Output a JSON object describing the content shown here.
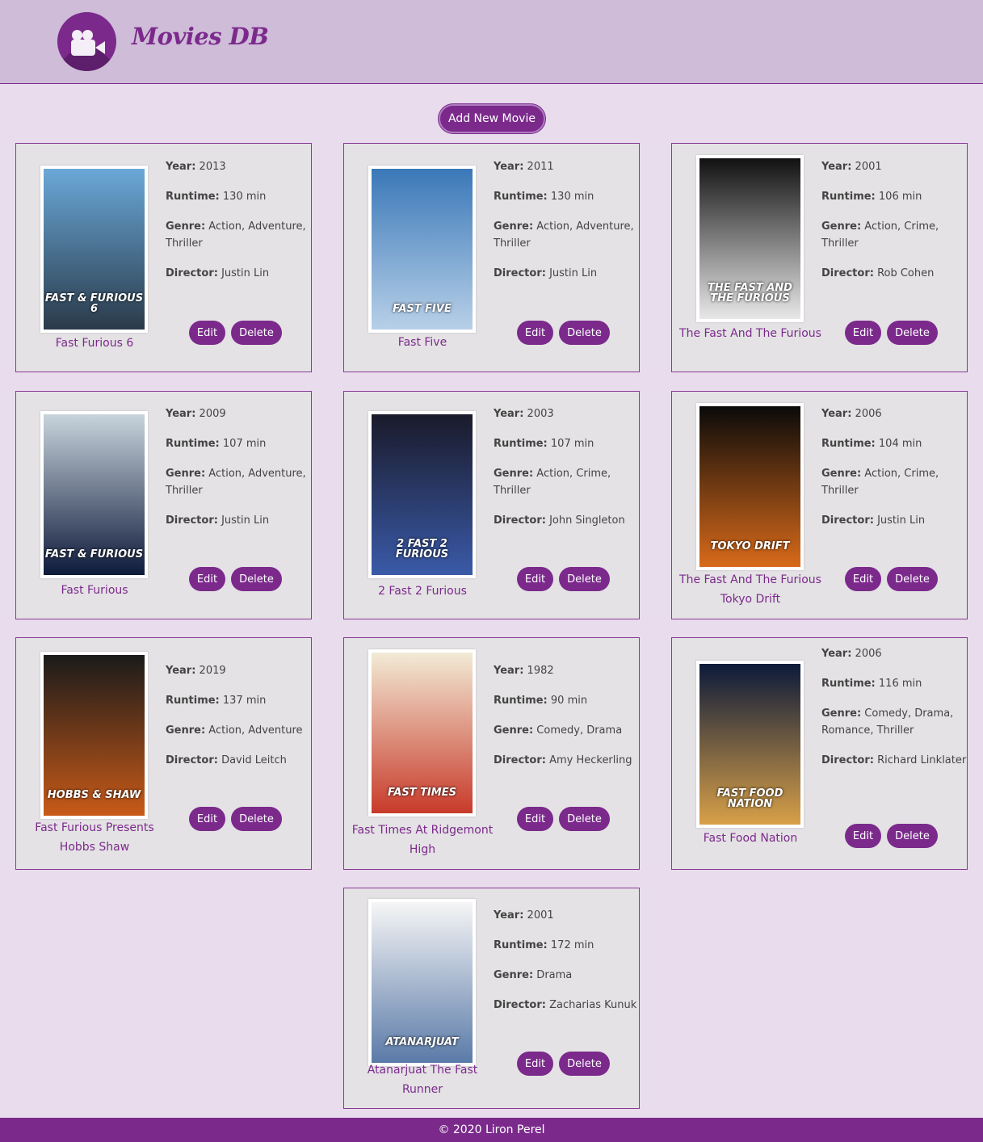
{
  "app": {
    "brand": "Movies DB"
  },
  "actions": {
    "add_label": "Add New Movie",
    "edit_label": "Edit",
    "delete_label": "Delete"
  },
  "labels": {
    "year": "Year:",
    "runtime": "Runtime:",
    "genre": "Genre:",
    "director": "Director:"
  },
  "movies": [
    {
      "title": "Fast Furious 6",
      "year": "2013",
      "runtime": "130 min",
      "genre": "Action, Adventure, Thriller",
      "director": "Justin Lin",
      "poster_text": "FAST & FURIOUS 6",
      "poster_colors": [
        "#6aa8d8",
        "#2a3a4a"
      ]
    },
    {
      "title": "Fast Five",
      "year": "2011",
      "runtime": "130 min",
      "genre": "Action, Adventure, Thriller",
      "director": "Justin Lin",
      "poster_text": "FAST FIVE",
      "poster_colors": [
        "#3a78b8",
        "#b8d0e8"
      ]
    },
    {
      "title": "The Fast And The Furious",
      "year": "2001",
      "runtime": "106 min",
      "genre": "Action, Crime, Thriller",
      "director": "Rob Cohen",
      "poster_text": "THE FAST AND THE FURIOUS",
      "poster_colors": [
        "#111111",
        "#e8e8e8"
      ]
    },
    {
      "title": "Fast Furious",
      "year": "2009",
      "runtime": "107 min",
      "genre": "Action, Adventure, Thriller",
      "director": "Justin Lin",
      "poster_text": "FAST & FURIOUS",
      "poster_colors": [
        "#c8d4dc",
        "#0e1a3a"
      ]
    },
    {
      "title": "2 Fast 2 Furious",
      "year": "2003",
      "runtime": "107 min",
      "genre": "Action, Crime, Thriller",
      "director": "John Singleton",
      "poster_text": "2 FAST 2 FURIOUS",
      "poster_colors": [
        "#1a1a2a",
        "#3a5aa8"
      ]
    },
    {
      "title": "The Fast And The Furious Tokyo Drift",
      "year": "2006",
      "runtime": "104 min",
      "genre": "Action, Crime, Thriller",
      "director": "Justin Lin",
      "poster_text": "TOKYO DRIFT",
      "poster_colors": [
        "#0a0a0a",
        "#d86a1a"
      ]
    },
    {
      "title": "Fast Furious Presents Hobbs Shaw",
      "year": "2019",
      "runtime": "137 min",
      "genre": "Action, Adventure",
      "director": "David Leitch",
      "poster_text": "HOBBS & SHAW",
      "poster_colors": [
        "#1a1a1a",
        "#c85a18"
      ]
    },
    {
      "title": "Fast Times At Ridgemont High",
      "year": "1982",
      "runtime": "90 min",
      "genre": "Comedy, Drama",
      "director": "Amy Heckerling",
      "poster_text": "FAST TIMES",
      "poster_colors": [
        "#f2ebd6",
        "#c83a2a"
      ]
    },
    {
      "title": "Fast Food Nation",
      "year": "2006",
      "runtime": "116 min",
      "genre": "Comedy, Drama, Romance, Thriller",
      "director": "Richard Linklater",
      "poster_text": "FAST FOOD NATION",
      "poster_colors": [
        "#0c1a3a",
        "#d8a048"
      ]
    },
    {
      "title": "Atanarjuat The Fast Runner",
      "year": "2001",
      "runtime": "172 min",
      "genre": "Drama",
      "director": "Zacharias Kunuk",
      "poster_text": "ATANARJUAT",
      "poster_colors": [
        "#f6f6f6",
        "#5a7aa8"
      ]
    }
  ],
  "footer": {
    "text": "© 2020 Liron Perel"
  },
  "colors": {
    "accent": "#7b2a8c",
    "background": "#e8dced",
    "header": "#cfbcd8",
    "card": "#e4e2e4"
  }
}
